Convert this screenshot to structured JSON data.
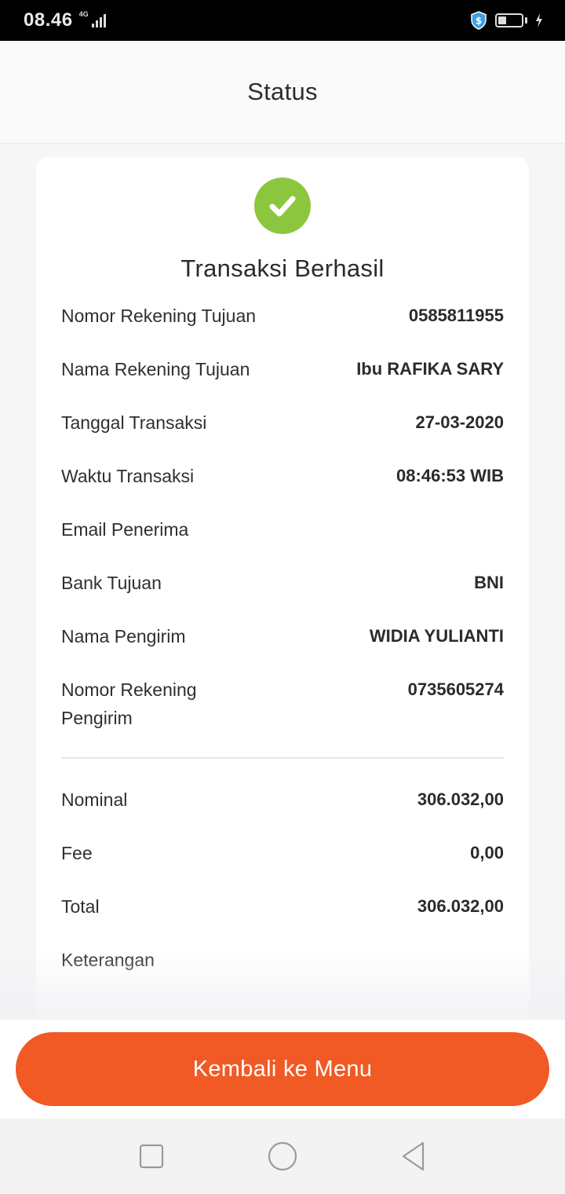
{
  "status_bar": {
    "time": "08.46",
    "network": "4G",
    "icons": [
      "signal-icon",
      "shield-dollar-icon",
      "battery-icon",
      "charging-icon"
    ]
  },
  "header": {
    "title": "Status"
  },
  "card": {
    "status_icon": "check-icon",
    "title": "Transaksi Berhasil",
    "details": [
      {
        "label": "Nomor Rekening Tujuan",
        "value": "0585811955"
      },
      {
        "label": "Nama Rekening Tujuan",
        "value": "Ibu RAFIKA SARY"
      },
      {
        "label": "Tanggal Transaksi",
        "value": "27-03-2020"
      },
      {
        "label": "Waktu Transaksi",
        "value": "08:46:53 WIB"
      },
      {
        "label": "Email Penerima",
        "value": ""
      },
      {
        "label": "Bank Tujuan",
        "value": "BNI"
      },
      {
        "label": "Nama Pengirim",
        "value": "WIDIA YULIANTI"
      },
      {
        "label": "Nomor Rekening Pengirim",
        "value": "0735605274"
      }
    ],
    "amounts": [
      {
        "label": "Nominal",
        "value": "306.032,00"
      },
      {
        "label": "Fee",
        "value": "0,00"
      },
      {
        "label": "Total",
        "value": "306.032,00"
      },
      {
        "label": "Keterangan",
        "value": ""
      }
    ]
  },
  "actions": {
    "back_to_menu": "Kembali ke Menu"
  },
  "navbar": {
    "icons": [
      "recents-icon",
      "home-icon",
      "back-icon"
    ]
  },
  "colors": {
    "accent": "#f15a24",
    "success": "#8cc63f"
  }
}
